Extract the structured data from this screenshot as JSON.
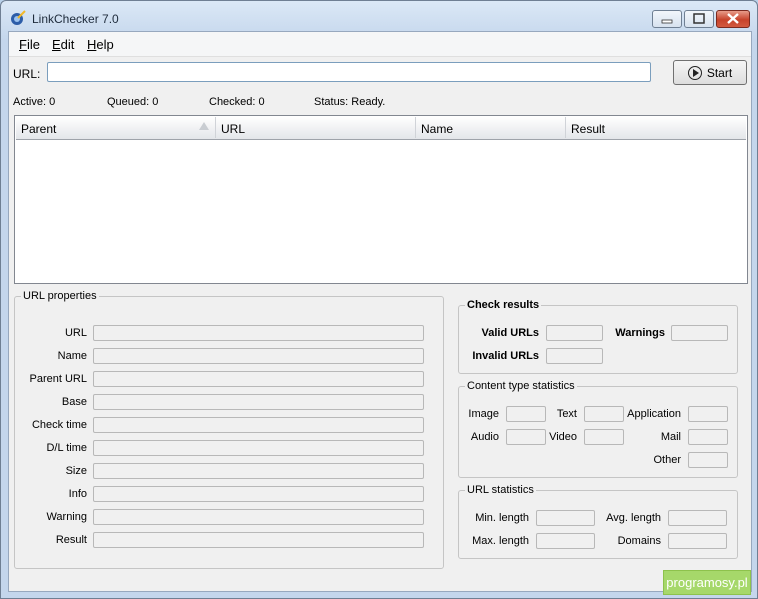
{
  "window": {
    "title": "LinkChecker 7.0"
  },
  "menu": {
    "file": {
      "underlined": "F",
      "rest": "ile"
    },
    "edit": {
      "underlined": "E",
      "rest": "dit"
    },
    "help": {
      "underlined": "H",
      "rest": "elp"
    }
  },
  "toolbar": {
    "url_label": "URL:",
    "url_value": "",
    "start_label": "Start"
  },
  "status": {
    "active": "Active:  0",
    "queued": "Queued:  0",
    "checked": "Checked:  0",
    "status": "Status:  Ready."
  },
  "table": {
    "columns": [
      "Parent",
      "URL",
      "Name",
      "Result"
    ]
  },
  "url_properties": {
    "title": "URL properties",
    "fields": [
      "URL",
      "Name",
      "Parent URL",
      "Base",
      "Check time",
      "D/L time",
      "Size",
      "Info",
      "Warning",
      "Result"
    ]
  },
  "check_results": {
    "title": "Check results",
    "valid": "Valid URLs",
    "warnings": "Warnings",
    "invalid": "Invalid URLs"
  },
  "content_type": {
    "title": "Content type statistics",
    "image": "Image",
    "text": "Text",
    "application": "Application",
    "audio": "Audio",
    "video": "Video",
    "mail": "Mail",
    "other": "Other"
  },
  "url_statistics": {
    "title": "URL statistics",
    "min_length": "Min. length",
    "avg_length": "Avg. length",
    "max_length": "Max. length",
    "domains": "Domains"
  },
  "watermark": "programosy.pl"
}
